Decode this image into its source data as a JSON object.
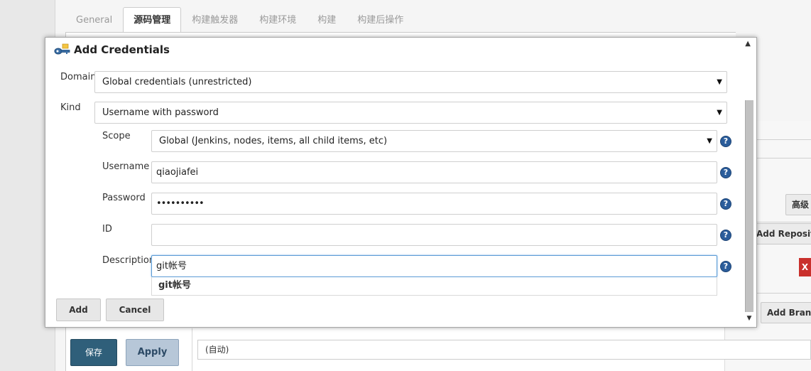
{
  "tabs": [
    {
      "label": "General"
    },
    {
      "label": "源码管理"
    },
    {
      "label": "构建触发器"
    },
    {
      "label": "构建环境"
    },
    {
      "label": "构建"
    },
    {
      "label": "构建后操作"
    }
  ],
  "background": {
    "advanced_button": "高级",
    "add_repository_button": "Add Repository",
    "add_branch_button": "Add Branch",
    "delete_button": "X",
    "field_value": "(自动)",
    "save_button": "保存",
    "apply_button": "Apply"
  },
  "dialog": {
    "title": "Add Credentials",
    "domain": {
      "label": "Domain",
      "value": "Global credentials (unrestricted)"
    },
    "kind": {
      "label": "Kind",
      "value": "Username with password"
    },
    "scope": {
      "label": "Scope",
      "value": "Global (Jenkins, nodes, items, all child items, etc)"
    },
    "username": {
      "label": "Username",
      "value": "qiaojiafei"
    },
    "password": {
      "label": "Password",
      "value": "••••••••••"
    },
    "id": {
      "label": "ID",
      "value": ""
    },
    "description": {
      "label": "Description",
      "value": "git帐号"
    },
    "autocomplete_suggestion": "git帐号",
    "add_button": "Add",
    "cancel_button": "Cancel",
    "help_glyph": "?"
  },
  "colors": {
    "save_button_bg": "#2f5f7a",
    "help_icon_bg": "#2b5d9b",
    "delete_button_bg": "#c9302c"
  }
}
